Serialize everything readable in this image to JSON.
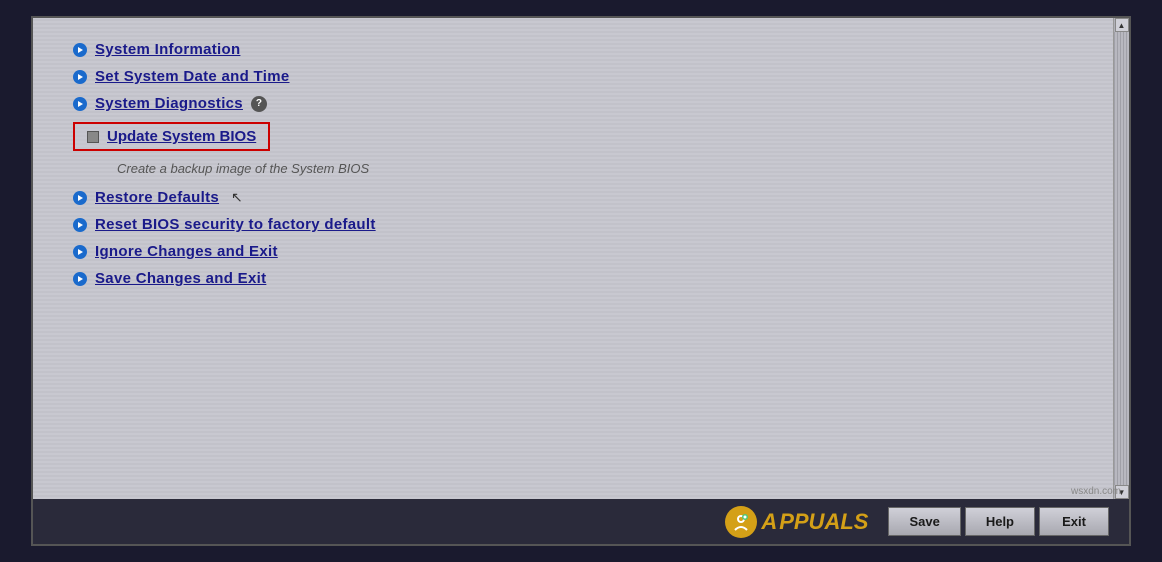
{
  "menu": {
    "items": [
      {
        "id": "system-information",
        "label": "System Information",
        "type": "arrow",
        "hasHelp": false
      },
      {
        "id": "set-system-date",
        "label": "Set System Date and Time",
        "type": "arrow",
        "hasHelp": false
      },
      {
        "id": "system-diagnostics",
        "label": "System Diagnostics",
        "type": "arrow",
        "hasHelp": true
      }
    ],
    "update_bios_label": "Update System BIOS",
    "backup_text": "Create a backup image of the System BIOS",
    "other_items": [
      {
        "id": "restore-defaults",
        "label": "Restore Defaults"
      },
      {
        "id": "reset-bios-security",
        "label": "Reset BIOS security to factory default"
      },
      {
        "id": "ignore-changes",
        "label": "Ignore Changes and Exit"
      },
      {
        "id": "save-changes",
        "label": "Save Changes and Exit"
      }
    ]
  },
  "bottom_buttons": [
    {
      "id": "save",
      "label": "Save"
    },
    {
      "id": "help",
      "label": "Help"
    },
    {
      "id": "exit",
      "label": "Exit"
    }
  ],
  "logo": {
    "text": "PPUALS",
    "icon": "A"
  },
  "watermark": "wsxdn.com"
}
